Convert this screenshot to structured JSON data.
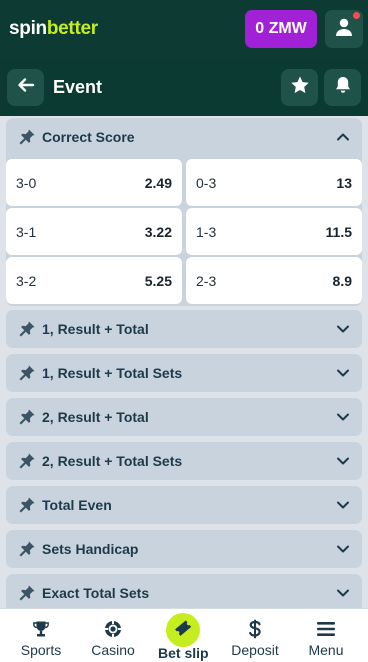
{
  "header": {
    "logo_part1": "spin",
    "logo_part2": "better",
    "balance": "0 ZMW"
  },
  "page": {
    "title": "Event"
  },
  "correct_score": {
    "title": "Correct Score",
    "odds": [
      {
        "label": "3-0",
        "value": "2.49"
      },
      {
        "label": "0-3",
        "value": "13"
      },
      {
        "label": "3-1",
        "value": "3.22"
      },
      {
        "label": "1-3",
        "value": "11.5"
      },
      {
        "label": "3-2",
        "value": "5.25"
      },
      {
        "label": "2-3",
        "value": "8.9"
      }
    ]
  },
  "markets": [
    {
      "title": "1, Result + Total"
    },
    {
      "title": "1, Result + Total Sets"
    },
    {
      "title": "2, Result + Total"
    },
    {
      "title": "2, Result + Total Sets"
    },
    {
      "title": "Total Even"
    },
    {
      "title": "Sets Handicap"
    },
    {
      "title": "Exact Total Sets"
    }
  ],
  "nav": {
    "sports": "Sports",
    "casino": "Casino",
    "betslip": "Bet slip",
    "deposit": "Deposit",
    "menu": "Menu"
  },
  "colors": {
    "header_bg": "#0d3a33",
    "accent_lime": "#c6ee1f",
    "balance_purple": "#a021d6"
  }
}
